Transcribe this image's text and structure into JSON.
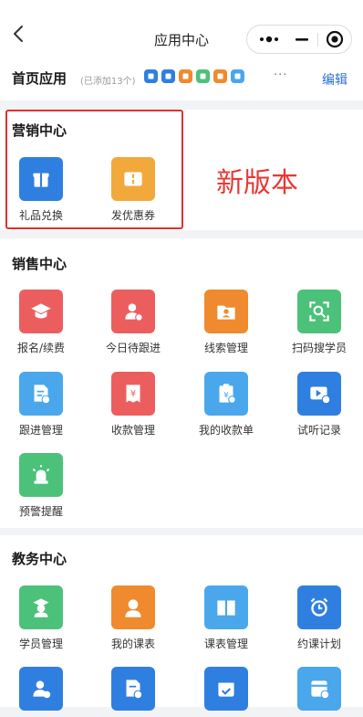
{
  "nav": {
    "title": "应用中心"
  },
  "home_apps": {
    "title": "首页应用",
    "added_text": "(已添加13个)",
    "more": "···",
    "edit_label": "编辑"
  },
  "marketing": {
    "title": "营销中心",
    "apps": [
      {
        "label": "礼品兑换",
        "icon": "gift-icon",
        "color": "#2f7fe0"
      },
      {
        "label": "发优惠券",
        "icon": "coupon-icon",
        "color": "#f2a93b"
      }
    ],
    "note": "新版本"
  },
  "sales": {
    "title": "销售中心",
    "apps": [
      {
        "label": "报名/续费",
        "icon": "graduation-cap-icon",
        "color": "#ec5e5e"
      },
      {
        "label": "今日待跟进",
        "icon": "person-follow-icon",
        "color": "#ec5e5e"
      },
      {
        "label": "线索管理",
        "icon": "folder-person-icon",
        "color": "#ef8a2f"
      },
      {
        "label": "扫码搜学员",
        "icon": "scan-search-icon",
        "color": "#4cc17a"
      },
      {
        "label": "跟进管理",
        "icon": "document-clock-icon",
        "color": "#4aa7ec"
      },
      {
        "label": "收款管理",
        "icon": "yen-receipt-icon",
        "color": "#ec5e5e"
      },
      {
        "label": "我的收款单",
        "icon": "clipboard-yen-icon",
        "color": "#4aa7ec"
      },
      {
        "label": "试听记录",
        "icon": "video-clock-icon",
        "color": "#2f7fe0"
      },
      {
        "label": "预警提醒",
        "icon": "alarm-light-icon",
        "color": "#4cc17a"
      }
    ]
  },
  "academic": {
    "title": "教务中心",
    "apps": [
      {
        "label": "学员管理",
        "icon": "student-icon",
        "color": "#4cc17a"
      },
      {
        "label": "我的课表",
        "icon": "teacher-icon",
        "color": "#ef8a2f"
      },
      {
        "label": "课表管理",
        "icon": "book-icon",
        "color": "#4aa7ec"
      },
      {
        "label": "约课计划",
        "icon": "alarm-clock-icon",
        "color": "#2f7fe0"
      },
      {
        "label": "",
        "icon": "person-check-icon",
        "color": "#2f7fe0"
      },
      {
        "label": "",
        "icon": "document-check-icon",
        "color": "#2f7fe0"
      },
      {
        "label": "",
        "icon": "calendar-check-icon",
        "color": "#2f7fe0"
      },
      {
        "label": "",
        "icon": "card-add-icon",
        "color": "#4aa7ec"
      }
    ]
  },
  "mini_icon_colors": [
    "#2f7fe0",
    "#2f7fe0",
    "#ef8a2f",
    "#4cc17a",
    "#ef8a2f",
    "#4aa7ec"
  ]
}
